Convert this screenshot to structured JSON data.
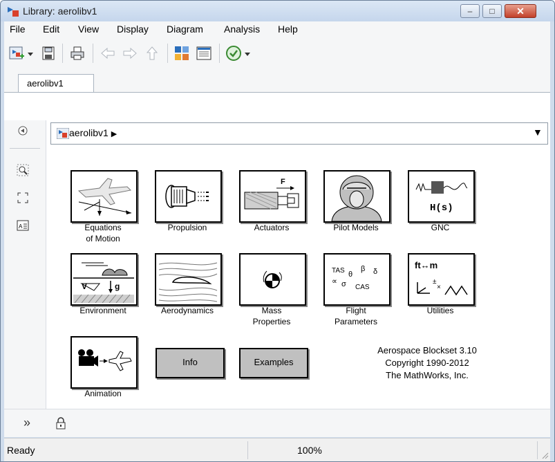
{
  "window": {
    "title": "Library: aerolibv1",
    "min_label": "–",
    "max_label": "□",
    "close_label": "✕"
  },
  "menu": {
    "items": [
      "File",
      "Edit",
      "View",
      "Display",
      "Diagram",
      "Analysis",
      "Help"
    ]
  },
  "toolbar": {
    "icons": [
      "new-library-icon",
      "save-icon",
      "print-icon",
      "back-icon",
      "forward-icon",
      "up-icon",
      "model-browser-icon",
      "library-browser-icon",
      "check-icon"
    ]
  },
  "tabs": [
    "aerolibv1"
  ],
  "address": {
    "path": "aerolibv1",
    "path_arrow": "▶",
    "dropdown_arrow": "▼"
  },
  "blocks": [
    {
      "label": "Equations\nof Motion",
      "icon": "equations-of-motion-icon"
    },
    {
      "label": "Propulsion",
      "icon": "propulsion-icon"
    },
    {
      "label": "Actuators",
      "icon": "actuators-icon"
    },
    {
      "label": "Pilot Models",
      "icon": "pilot-models-icon"
    },
    {
      "label": "GNC",
      "icon": "gnc-icon"
    },
    {
      "label": "Environment",
      "icon": "environment-icon"
    },
    {
      "label": "Aerodynamics",
      "icon": "aerodynamics-icon"
    },
    {
      "label": "Mass\nProperties",
      "icon": "mass-properties-icon"
    },
    {
      "label": "Flight\nParameters",
      "icon": "flight-parameters-icon"
    },
    {
      "label": "Utilities",
      "icon": "utilities-icon"
    },
    {
      "label": "Animation",
      "icon": "animation-icon"
    }
  ],
  "icon_text": {
    "actuator_force": "F",
    "gnc_transfer": "H(s)",
    "flight_params": [
      "TAS",
      "θ",
      "β",
      "δ",
      "∝",
      "σ",
      "CAS"
    ],
    "utilities_units": "ft↔m"
  },
  "buttons": {
    "info": "Info",
    "examples": "Examples"
  },
  "info": {
    "line1": "Aerospace Blockset 3.10",
    "line2": "Copyright 1990-2012",
    "line3": "The MathWorks, Inc."
  },
  "bottom": {
    "expand": "»",
    "lock": "🔒"
  },
  "status": {
    "text": "Ready",
    "zoom": "100%"
  },
  "colors": {
    "title_bar": "#c5d6ec",
    "close_button": "#c2402a",
    "canvas": "#ffffff",
    "button_fill": "#c0c0c0"
  }
}
